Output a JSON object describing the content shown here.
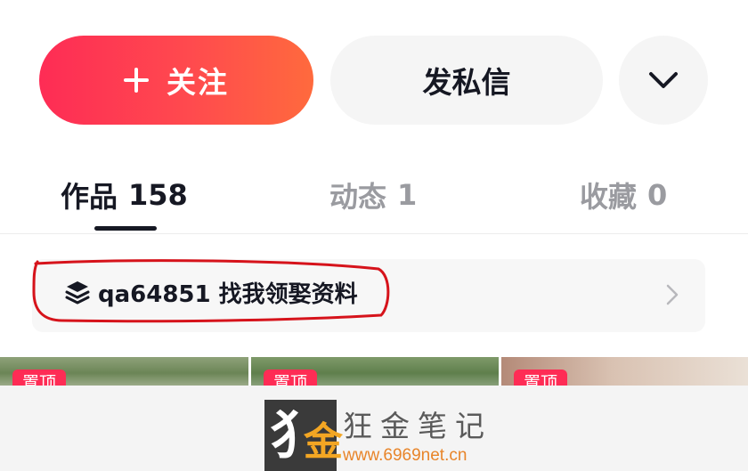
{
  "actions": {
    "follow_label": "关注",
    "message_label": "发私信",
    "more_icon": "chevron-down-icon"
  },
  "tabs": [
    {
      "label": "作品",
      "count": "158",
      "active": true
    },
    {
      "label": "动态",
      "count": "1",
      "active": false
    },
    {
      "label": "收藏",
      "count": "0",
      "active": false
    }
  ],
  "collection": {
    "icon": "layers-icon",
    "text": "qa64851 找我领娶资料",
    "arrow_icon": "chevron-right-icon"
  },
  "posts": [
    {
      "badge": "置顶"
    },
    {
      "badge": "置顶"
    },
    {
      "badge": "置顶"
    }
  ],
  "watermark": {
    "logo_glyph": "犭",
    "logo_glyph_accent": "金",
    "title": "狂金笔记",
    "url": "www.6969net.cn"
  },
  "colors": {
    "accent": "#fe2c55",
    "accent_end": "#ff6a3d",
    "annotation": "#d6131b",
    "watermark_url": "#e8852a"
  }
}
